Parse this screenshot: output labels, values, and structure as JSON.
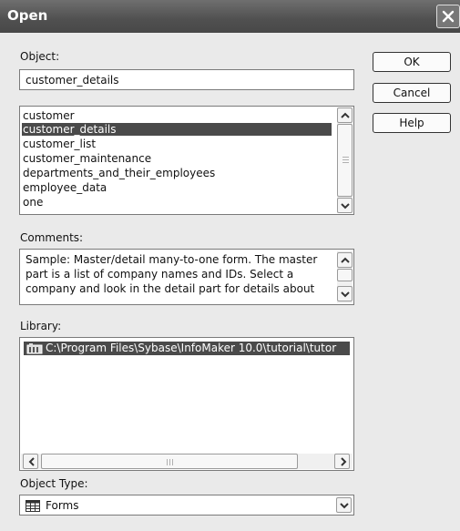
{
  "window": {
    "title": "Open"
  },
  "object": {
    "label": "Object:",
    "value": "customer_details"
  },
  "buttons": {
    "ok": "OK",
    "cancel": "Cancel",
    "help": "Help"
  },
  "object_list": {
    "items": [
      "customer",
      "customer_details",
      "customer_list",
      "customer_maintenance",
      "departments_and_their_employees",
      "employee_data",
      "one"
    ],
    "selected": "customer_details"
  },
  "comments": {
    "label": "Comments:",
    "text": "Sample: Master/detail many-to-one form. The master part is a list of company names and IDs. Select a company and look in the detail part for details about"
  },
  "library": {
    "label": "Library:",
    "path": "C:\\Program Files\\Sybase\\InfoMaker 10.0\\tutorial\\tutor"
  },
  "object_type": {
    "label": "Object Type:",
    "value": "Forms"
  },
  "colors": {
    "selection": "#4a4a4a",
    "title_bar": "#505050"
  }
}
